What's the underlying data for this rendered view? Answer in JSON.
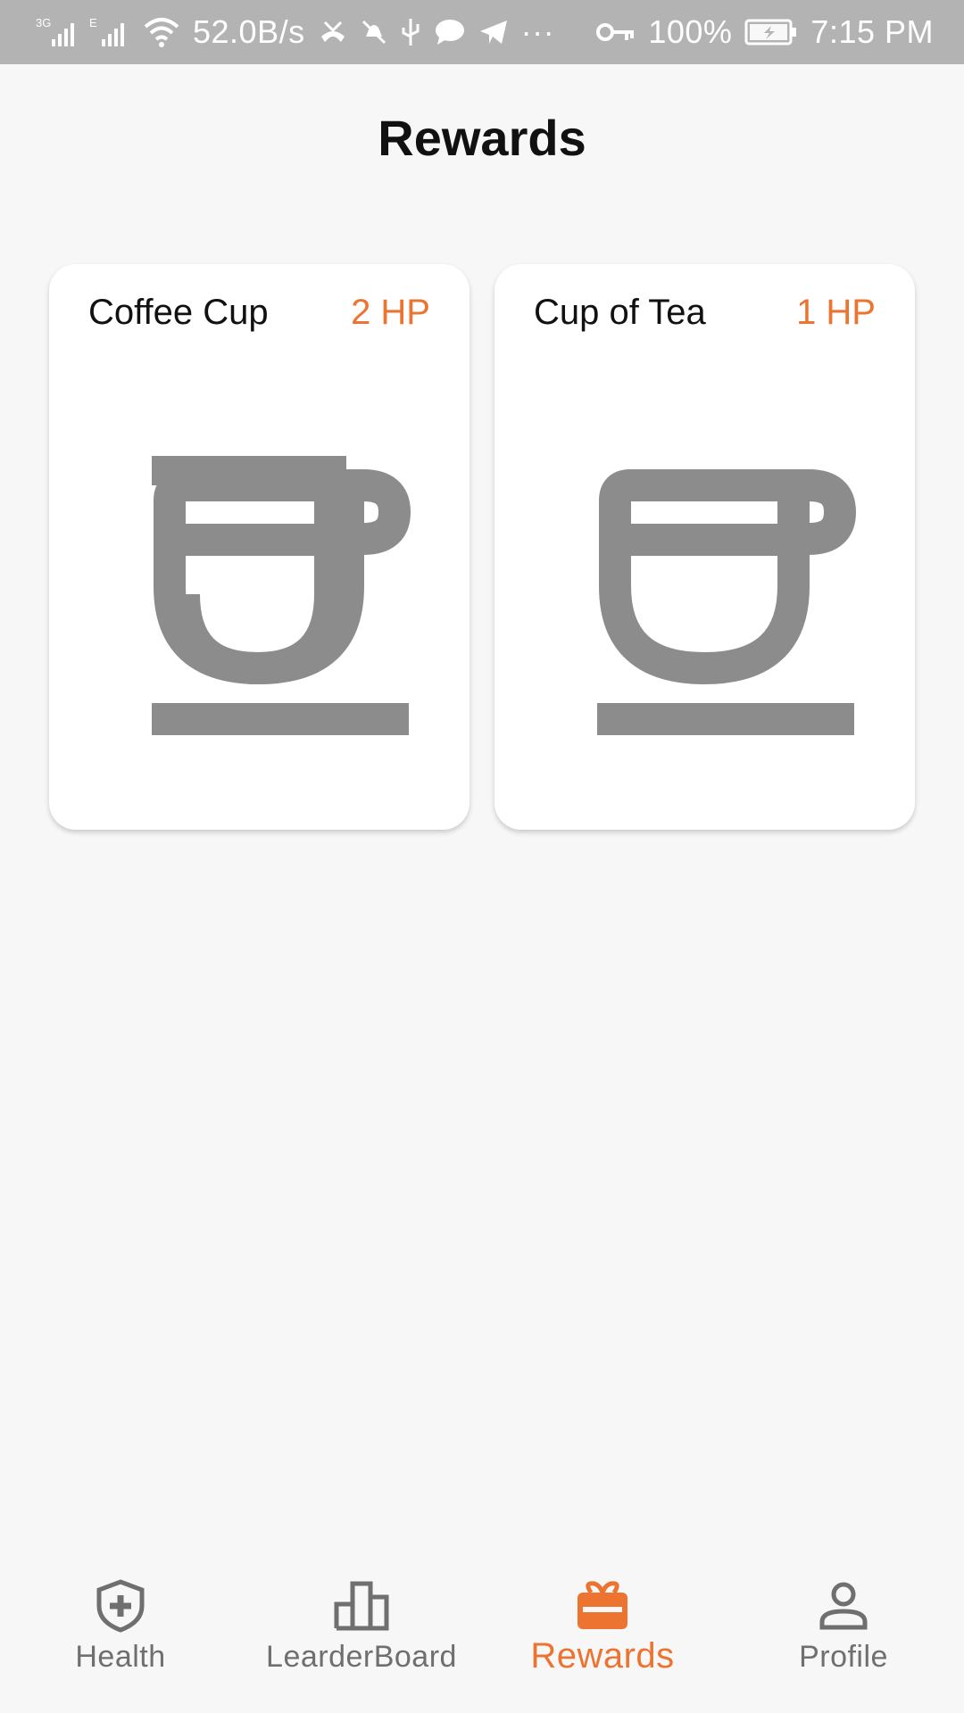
{
  "status_bar": {
    "network_1": "3G",
    "network_2": "E",
    "speed": "52.0B/s",
    "battery": "100%",
    "time": "7:15 PM",
    "overflow": "···"
  },
  "header": {
    "title": "Rewards"
  },
  "rewards": [
    {
      "name": "Coffee Cup",
      "points": "2 HP",
      "icon": "coffee-cup-icon"
    },
    {
      "name": "Cup of Tea",
      "points": "1 HP",
      "icon": "tea-cup-icon"
    }
  ],
  "nav": {
    "items": [
      {
        "label": "Health",
        "icon": "shield-plus-icon"
      },
      {
        "label": "LearderBoard",
        "icon": "leaderboard-icon"
      },
      {
        "label": "Rewards",
        "icon": "gift-icon",
        "active": true
      },
      {
        "label": "Profile",
        "icon": "person-icon"
      }
    ]
  },
  "colors": {
    "accent": "#ec7430",
    "icon_gray": "#8c8c8c",
    "status_bar": "#b3b3b3"
  }
}
